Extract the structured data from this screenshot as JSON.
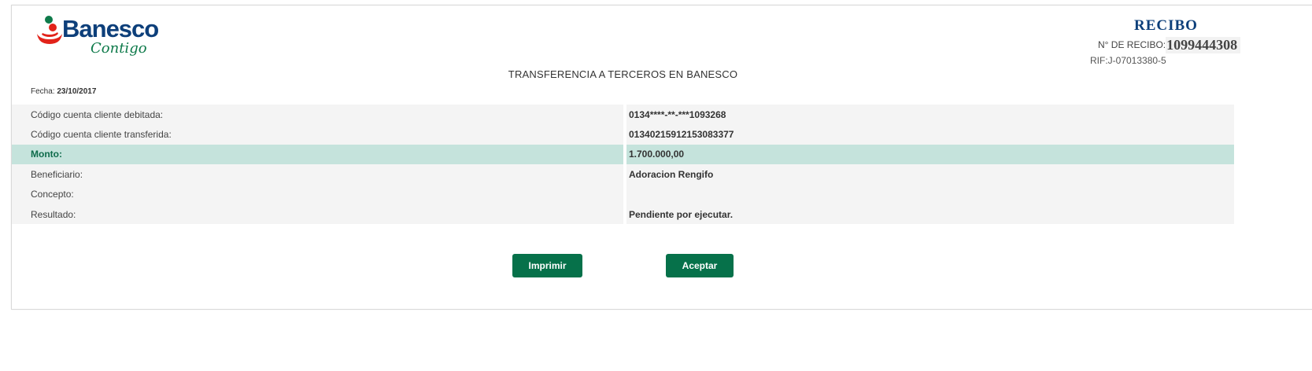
{
  "brand": {
    "name": "Banesco",
    "tagline": "Contigo",
    "colors": {
      "navy": "#0d3f7a",
      "green": "#0e7a4a",
      "red": "#e2231a",
      "highlight_row": "#c5e3dc",
      "button": "#06714a"
    }
  },
  "receipt": {
    "title": "RECIBO",
    "number_label": "N° DE RECIBO:",
    "number": "1099444308",
    "rif": "RIF:J-07013380-5",
    "heading": "TRANSFERENCIA A TERCEROS EN BANESCO",
    "date_label": "Fecha:",
    "date": "23/10/2017"
  },
  "details": [
    {
      "label": "Código cuenta cliente debitada:",
      "value": "0134****-**-***1093268",
      "highlight": false
    },
    {
      "label": "Código cuenta cliente transferida:",
      "value": "01340215912153083377",
      "highlight": false
    },
    {
      "label": "Monto:",
      "value": "1.700.000,00",
      "highlight": true
    },
    {
      "label": "Beneficiario:",
      "value": "Adoracion Rengifo",
      "highlight": false
    },
    {
      "label": "Concepto:",
      "value": "",
      "highlight": false
    },
    {
      "label": "Resultado:",
      "value": "Pendiente por ejecutar.",
      "highlight": false
    }
  ],
  "actions": {
    "print_label": "Imprimir",
    "accept_label": "Aceptar"
  }
}
